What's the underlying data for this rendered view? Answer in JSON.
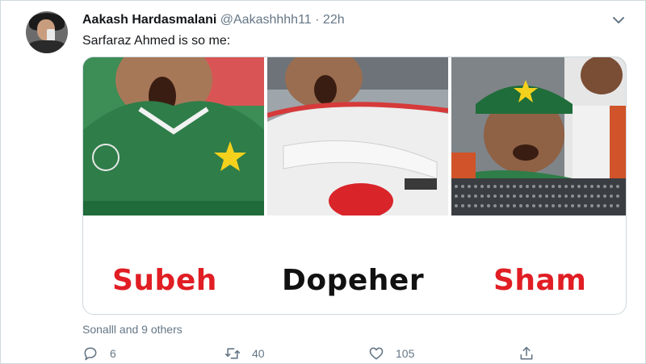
{
  "tweet": {
    "author_name": "Aakash Hardasmalani",
    "handle": "@Aakashhhh11",
    "separator": "·",
    "time": "22h",
    "text": "Sarfaraz Ahmed is so me:"
  },
  "media": {
    "captions": [
      "Subeh",
      "Dopeher",
      "Sham"
    ]
  },
  "likers_text": "Sonalll and 9 others",
  "actions": {
    "reply_count": "6",
    "retweet_count": "40",
    "like_count": "105"
  },
  "icons": {
    "reply": "reply-icon",
    "retweet": "retweet-icon",
    "like": "heart-icon",
    "share": "share-icon",
    "menu": "chevron-down-icon"
  },
  "colors": {
    "caption_red": "#e01e24",
    "caption_black": "#111111",
    "meta_gray": "#657786"
  }
}
